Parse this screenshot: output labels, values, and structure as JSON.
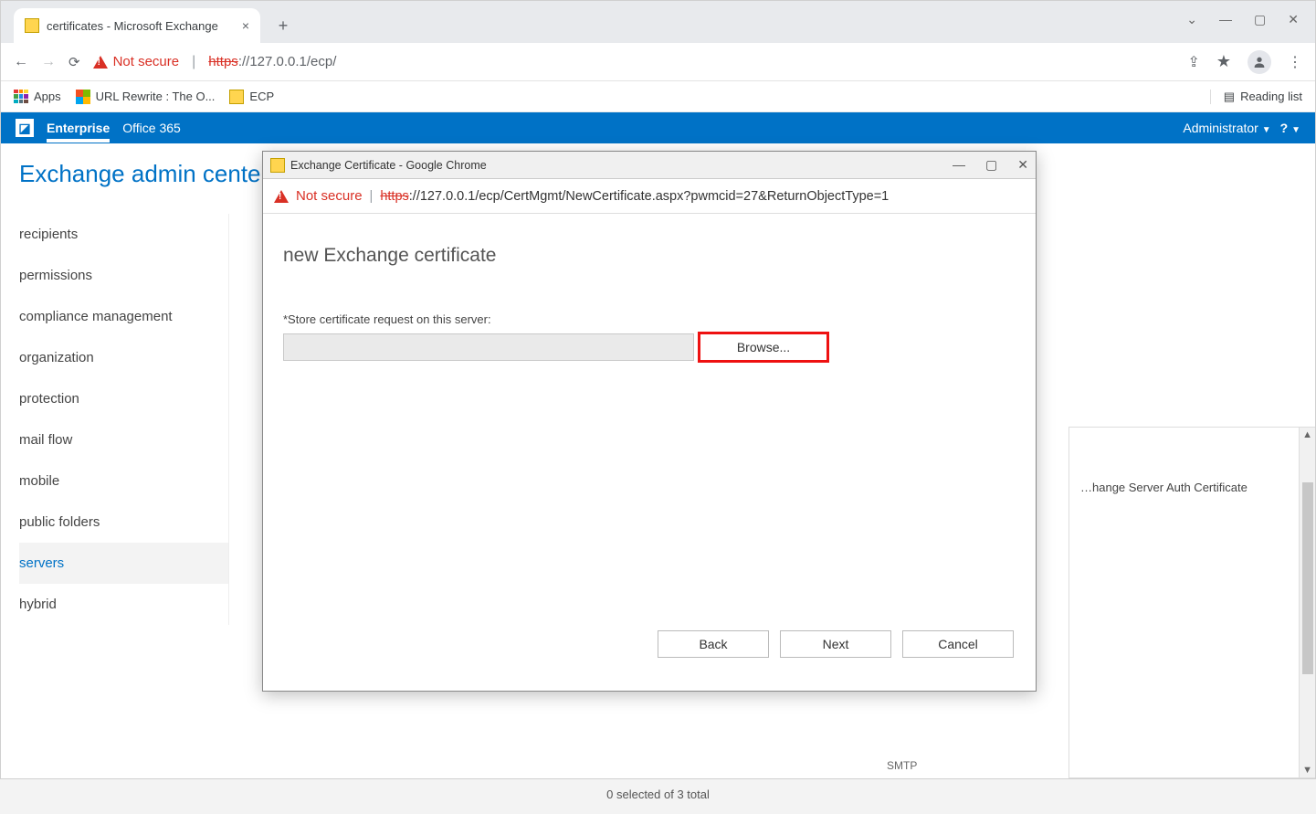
{
  "browser": {
    "tab_title": "certificates - Microsoft Exchange",
    "not_secure": "Not secure",
    "url_scheme": "https",
    "url_rest": "://127.0.0.1/ecp/",
    "bookmarks_bar": {
      "apps": "Apps",
      "url_rewrite": "URL Rewrite : The O...",
      "ecp": "ECP",
      "reading_list": "Reading list"
    }
  },
  "o365": {
    "enterprise": "Enterprise",
    "office365": "Office 365",
    "admin": "Administrator",
    "help": "?"
  },
  "app": {
    "title": "Exchange admin center",
    "nav": [
      "recipients",
      "permissions",
      "compliance management",
      "organization",
      "protection",
      "mail flow",
      "mobile",
      "public folders",
      "servers",
      "hybrid"
    ],
    "selected_nav": "servers",
    "detail_line": "…hange Server Auth Certificate",
    "smtp": "SMTP",
    "status": "0 selected of 3 total"
  },
  "popup": {
    "window_title": "Exchange Certificate - Google Chrome",
    "not_secure": "Not secure",
    "url_scheme": "https",
    "url_rest": "://127.0.0.1/ecp/CertMgmt/NewCertificate.aspx?pwmcid=27&ReturnObjectType=1",
    "heading": "new Exchange certificate",
    "field_label": "*Store certificate request on this server:",
    "browse": "Browse...",
    "back": "Back",
    "next": "Next",
    "cancel": "Cancel"
  }
}
